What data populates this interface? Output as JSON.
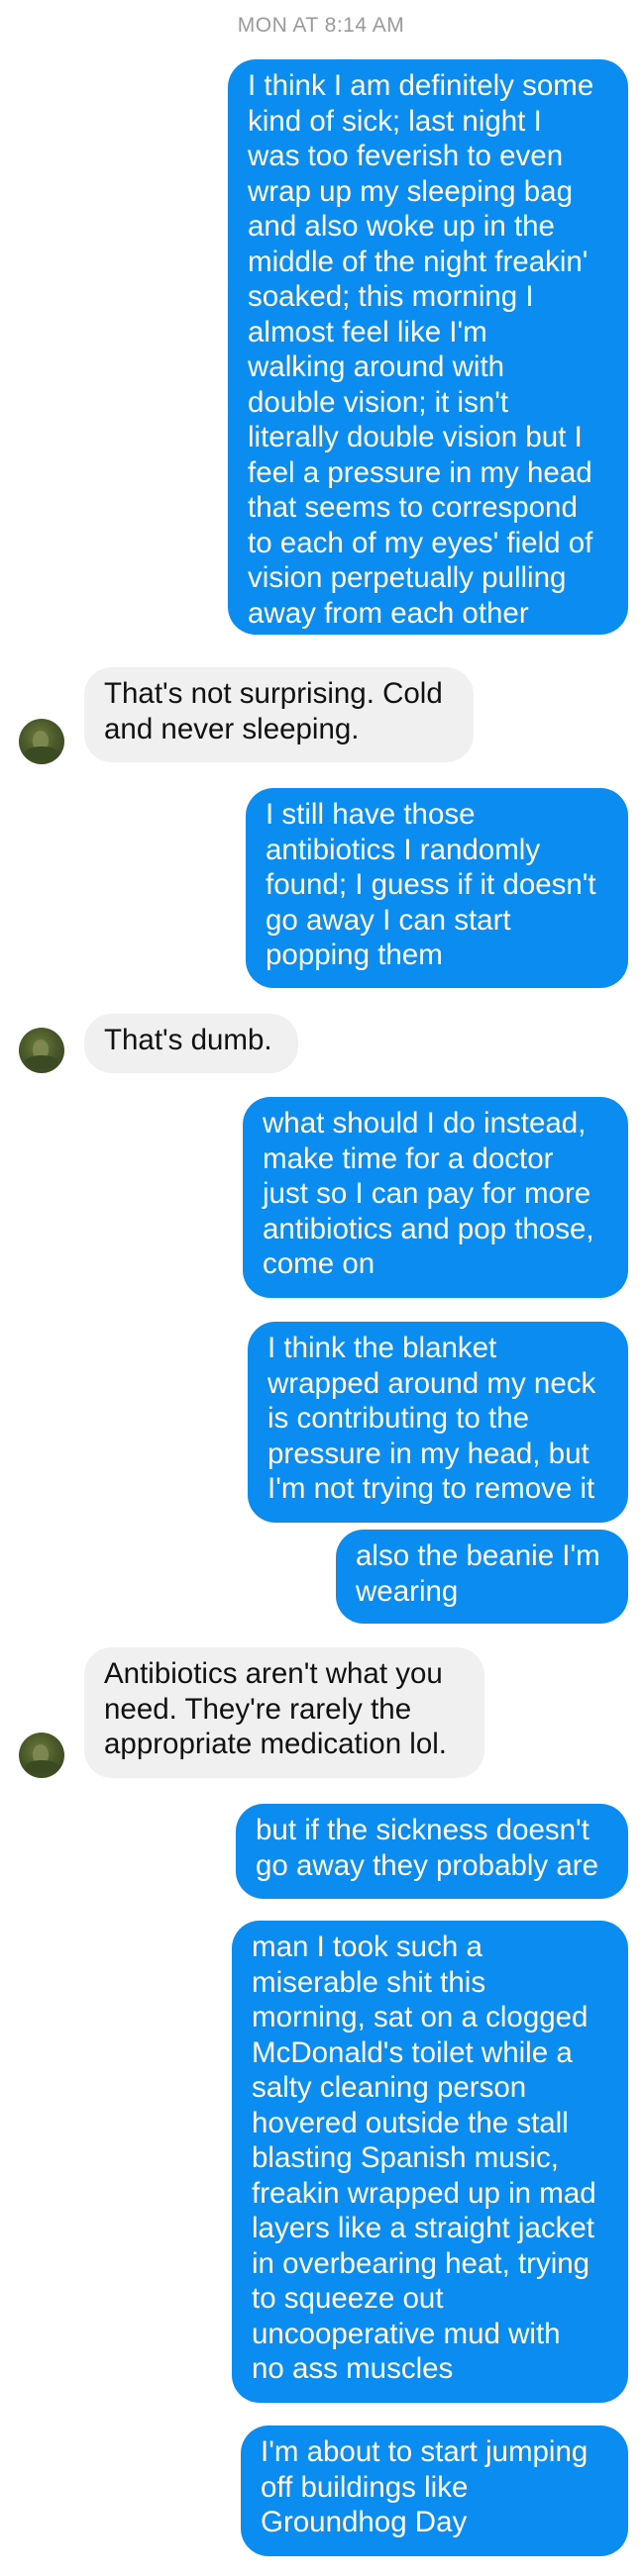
{
  "thread": {
    "timestamp": "MON AT 8:14 AM"
  },
  "messages": [
    {
      "sender": "me",
      "text": "I think I am definitely some\nkind of sick; last night I\nwas too feverish to even\nwrap up my sleeping bag\nand also woke up in the\nmiddle of the night freakin'\nsoaked; this morning I\nalmost feel like I'm\nwalking around with\ndouble vision; it isn't\nliterally double vision but I\nfeel a pressure in my head\nthat seems to correspond\nto each of my eyes' field of\nvision perpetually pulling\naway from each other"
    },
    {
      "sender": "them",
      "text": "That's not surprising. Cold\nand never sleeping."
    },
    {
      "sender": "me",
      "text": "I still have those\nantibiotics I randomly\nfound; I guess if it doesn't\ngo away I can start\npopping them"
    },
    {
      "sender": "them",
      "text": "That's dumb."
    },
    {
      "sender": "me",
      "text": "what should I do instead,\nmake time for a doctor\njust so I can pay for more\nantibiotics and pop those,\ncome on"
    },
    {
      "sender": "me",
      "text": "I think the blanket\nwrapped around my neck\nis contributing to the\npressure in my head, but\nI'm not trying to remove it"
    },
    {
      "sender": "me",
      "text": "also the beanie I'm\nwearing"
    },
    {
      "sender": "them",
      "text": "Antibiotics aren't what you\nneed. They're rarely the\nappropriate medication lol."
    },
    {
      "sender": "me",
      "text": "but if the sickness doesn't\ngo away they probably are"
    },
    {
      "sender": "me",
      "text": "man I took such a\nmiserable shit this\nmorning, sat on a clogged\nMcDonald's toilet while a\nsalty cleaning person\nhovered outside the stall\nblasting Spanish music,\nfreakin wrapped up in mad\nlayers like a straight jacket\nin overbearing heat, trying\nto squeeze out\nuncooperative mud with\nno ass muscles"
    },
    {
      "sender": "me",
      "text": "I'm about to start jumping\noff buildings like\nGroundhog Day"
    }
  ],
  "colors": {
    "sent_bubble": "#0a8cf0",
    "received_bubble": "#f0f0f0",
    "timestamp_text": "#9a9a9a"
  }
}
